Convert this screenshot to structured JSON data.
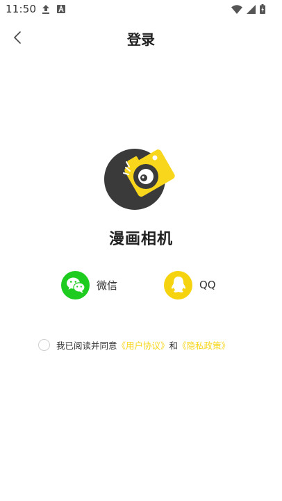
{
  "status_bar": {
    "time": "11:50"
  },
  "header": {
    "title": "登录"
  },
  "app": {
    "name": "漫画相机"
  },
  "login_options": {
    "wechat": {
      "label": "微信"
    },
    "qq": {
      "label": "QQ"
    }
  },
  "agreement": {
    "prefix": "我已阅读并同意",
    "user_agreement": "《用户协议》",
    "conjunction": "和",
    "privacy_policy": "《隐私政策》"
  },
  "colors": {
    "accent_yellow": "#F7D61C",
    "wechat_green": "#1ECC20",
    "qq_yellow": "#F5D30F",
    "logo_dark": "#3A3A3A"
  }
}
